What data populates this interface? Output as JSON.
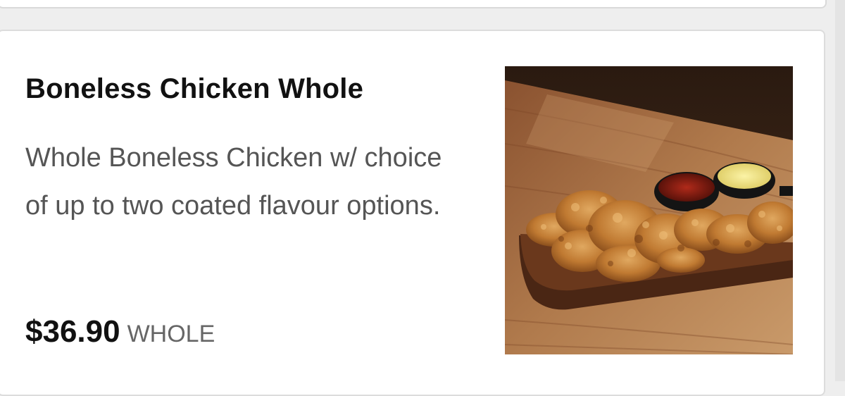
{
  "menu_item": {
    "title": "Boneless Chicken Whole",
    "description": "Whole Boneless Chicken w/ choice of up to two coated flavour options.",
    "price": "$36.90",
    "unit": "WHOLE",
    "image_alt": "Boneless chicken on a wooden serving board with two dipping sauces"
  }
}
